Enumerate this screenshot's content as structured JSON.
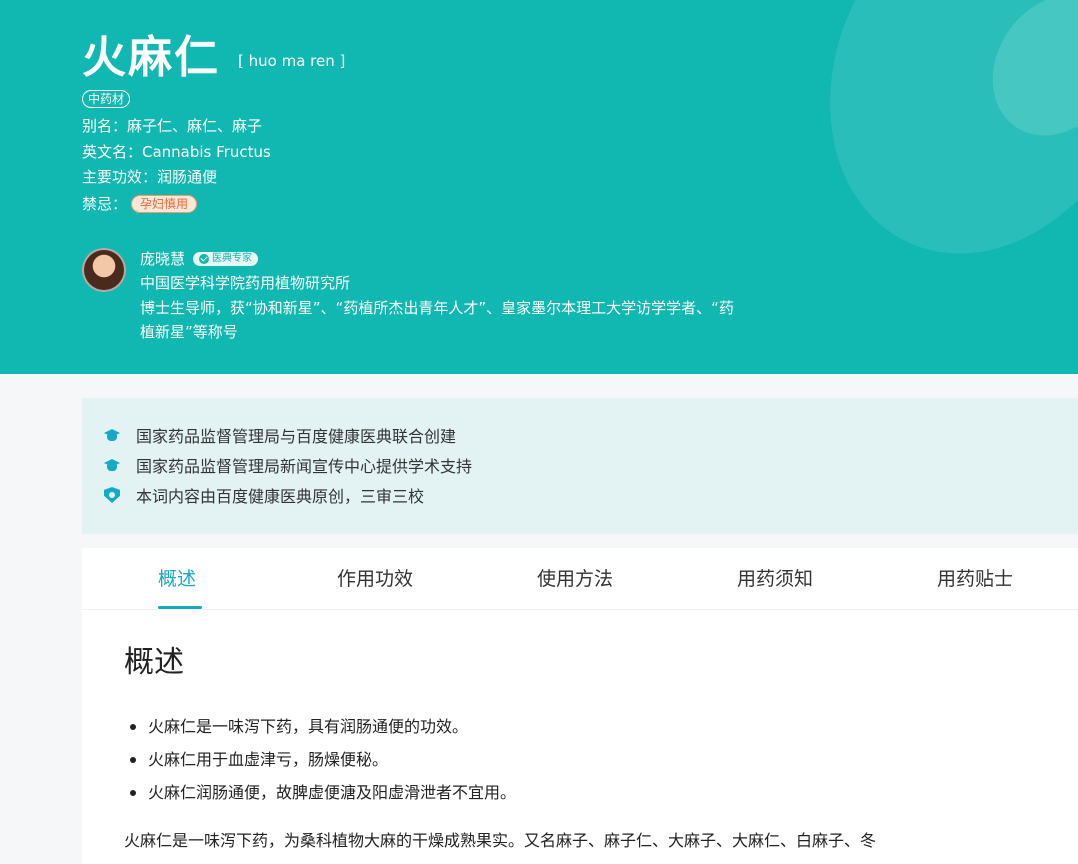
{
  "herb": {
    "title": "火麻仁",
    "pinyin": "[ huo ma ren ]",
    "category_tag": "中药材",
    "alias": "别名：麻子仁、麻仁、麻子",
    "english_name": "英文名：Cannabis Fructus",
    "main_effect": "主要功效：润肠通便",
    "taboo_label": "禁忌：",
    "taboo_badge": "孕妇慎用"
  },
  "expert": {
    "name": "庞晓慧",
    "badge": "医典专家",
    "org": "中国医学科学院药用植物研究所",
    "desc": "博士生导师，获“协和新星”、“药植所杰出青年人才”、皇家墨尔本理工大学访学学者、“药植新星”等称号"
  },
  "notices": [
    {
      "icon": "graduation-cap-icon",
      "text": "国家药品监督管理局与百度健康医典联合创建"
    },
    {
      "icon": "graduation-cap-icon",
      "text": "国家药品监督管理局新闻宣传中心提供学术支持"
    },
    {
      "icon": "shield-icon",
      "text": "本词内容由百度健康医典原创，三审三校"
    }
  ],
  "tabs": [
    "概述",
    "作用功效",
    "使用方法",
    "用药须知",
    "用药贴士"
  ],
  "section": {
    "title": "概述",
    "bullets": [
      "火麻仁是一味泻下药，具有润肠通便的功效。",
      "火麻仁用于血虚津亏，肠燥便秘。",
      "火麻仁润肠通便，故脾虚便溏及阳虚滑泄者不宜用。"
    ],
    "paragraph": "火麻仁是一味泻下药，为桑科植物大麻的干燥成熟果实。又名麻子、麻子仁、大麻子、大麻仁、白麻子、冬"
  },
  "colors": {
    "hero": "#11b7b1",
    "accent": "#19a8c2",
    "notice_bg": "#e3f2f3",
    "taboo": "#e2683a"
  }
}
